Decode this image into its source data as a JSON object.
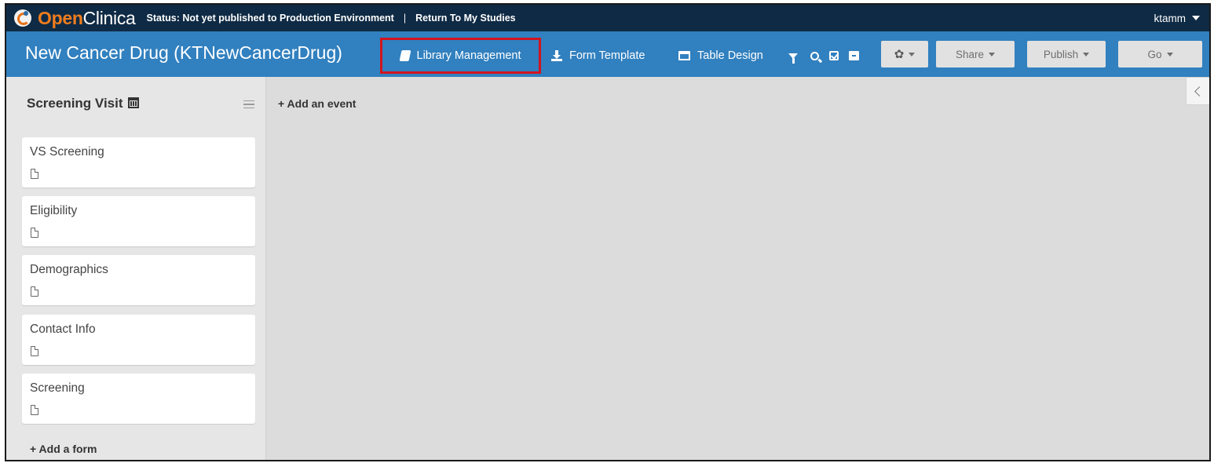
{
  "topbar": {
    "logo_open": "Open",
    "logo_clinica": "Clinica",
    "status": "Status: Not yet published to Production Environment",
    "separator": "|",
    "return_link": "Return To My Studies",
    "user": "ktamm"
  },
  "study": {
    "title": "New Cancer Drug (KTNewCancerDrug)",
    "toolbar": {
      "library_management": "Library Management",
      "form_template": "Form Template",
      "table_design": "Table Design",
      "share": "Share",
      "publish": "Publish",
      "go": "Go"
    },
    "highlight_color": "#d2141f"
  },
  "event": {
    "name": "Screening Visit",
    "forms": [
      {
        "name": "VS Screening"
      },
      {
        "name": "Eligibility"
      },
      {
        "name": "Demographics"
      },
      {
        "name": "Contact Info"
      },
      {
        "name": "Screening"
      }
    ],
    "add_form": "+ Add a form"
  },
  "main": {
    "add_event": "+ Add an event"
  },
  "colors": {
    "topbar": "#0f2a44",
    "studybar": "#3180bf",
    "logo_orange": "#f07d1d",
    "canvas": "#dcdcdc"
  }
}
